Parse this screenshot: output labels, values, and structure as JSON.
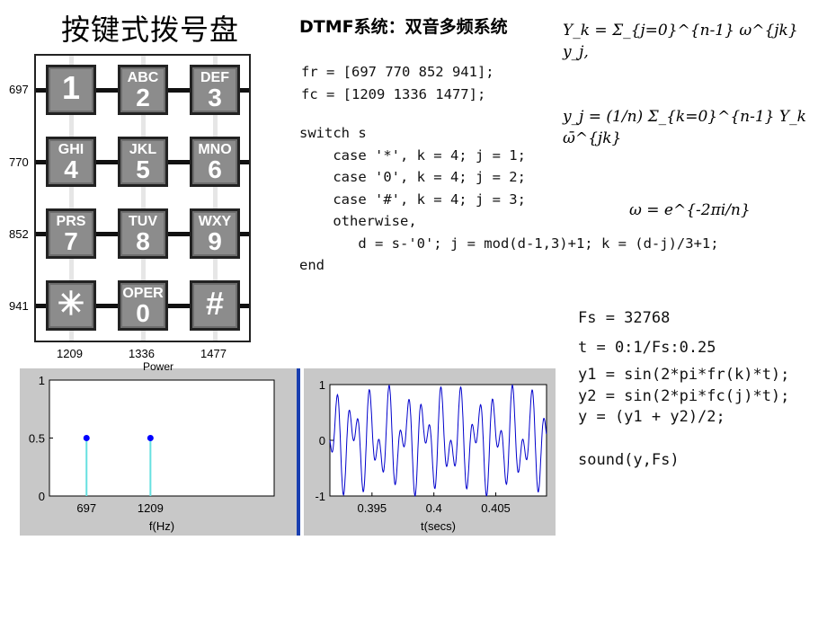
{
  "title": "按键式拨号盘",
  "subtitle": "DTMF系统：双音多频系统",
  "keypad": {
    "row_freqs": [
      "697",
      "770",
      "852",
      "941"
    ],
    "col_freqs": [
      "1209",
      "1336",
      "1477"
    ],
    "keys": [
      {
        "letters": "",
        "digit": "1"
      },
      {
        "letters": "ABC",
        "digit": "2"
      },
      {
        "letters": "DEF",
        "digit": "3"
      },
      {
        "letters": "GHI",
        "digit": "4"
      },
      {
        "letters": "JKL",
        "digit": "5"
      },
      {
        "letters": "MNO",
        "digit": "6"
      },
      {
        "letters": "PRS",
        "digit": "7"
      },
      {
        "letters": "TUV",
        "digit": "8"
      },
      {
        "letters": "WXY",
        "digit": "9"
      },
      {
        "letters": "",
        "digit": "✳"
      },
      {
        "letters": "OPER",
        "digit": "0"
      },
      {
        "letters": "",
        "digit": "#"
      }
    ]
  },
  "code": {
    "freqs": "fr = [697 770 852 941];\nfc = [1209 1336 1477];",
    "switch": "switch s\n    case '*', k = 4; j = 1;\n    case '0', k = 4; j = 2;\n    case '#', k = 4; j = 3;\n    otherwise,\n       d = s-'0'; j = mod(d-1,3)+1; k = (d-j)/3+1;\nend",
    "fs": "Fs = 32768\nt = 0:1/Fs:0.25",
    "signal": "y1 = sin(2*pi*fr(k)*t);\ny2 = sin(2*pi*fc(j)*t);\ny = (y1 + y2)/2;",
    "sound": "sound(y,Fs)"
  },
  "formulas": {
    "dft": "Y_k = Σ_{j=0}^{n-1} ω^{jk} y_j,",
    "idft": "y_j = (1/n) Σ_{k=0}^{n-1} Y_k ω̄^{jk}",
    "omega": "ω = e^{-2πi/n}"
  },
  "chart_data": [
    {
      "type": "stem",
      "title": "Power",
      "xlabel": "f(Hz)",
      "ylabel": "",
      "x": [
        697,
        1209
      ],
      "values": [
        0.5,
        0.5
      ],
      "xticks": [
        "697",
        "1209"
      ],
      "yticks": [
        "0",
        "0.5",
        "1"
      ],
      "ylim": [
        0,
        1
      ],
      "xlim": [
        400,
        2200
      ],
      "colors": {
        "stem": "#66e0e0",
        "marker": "#0000ff"
      }
    },
    {
      "type": "line",
      "xlabel": "t(secs)",
      "ylabel": "",
      "xticks": [
        "0.395",
        "0.4",
        "0.405"
      ],
      "yticks": [
        "-1",
        "0",
        "1"
      ],
      "xlim": [
        0.3916,
        0.4091
      ],
      "ylim": [
        -1,
        1
      ],
      "series_formula": "(sin(2*pi*697*t)+sin(2*pi*1209*t))/2",
      "colors": {
        "line": "#0000cc"
      }
    }
  ],
  "colors": {
    "panel": "#c8c8c8",
    "divider": "#1a3fb0",
    "key": "#8c8c8c"
  }
}
